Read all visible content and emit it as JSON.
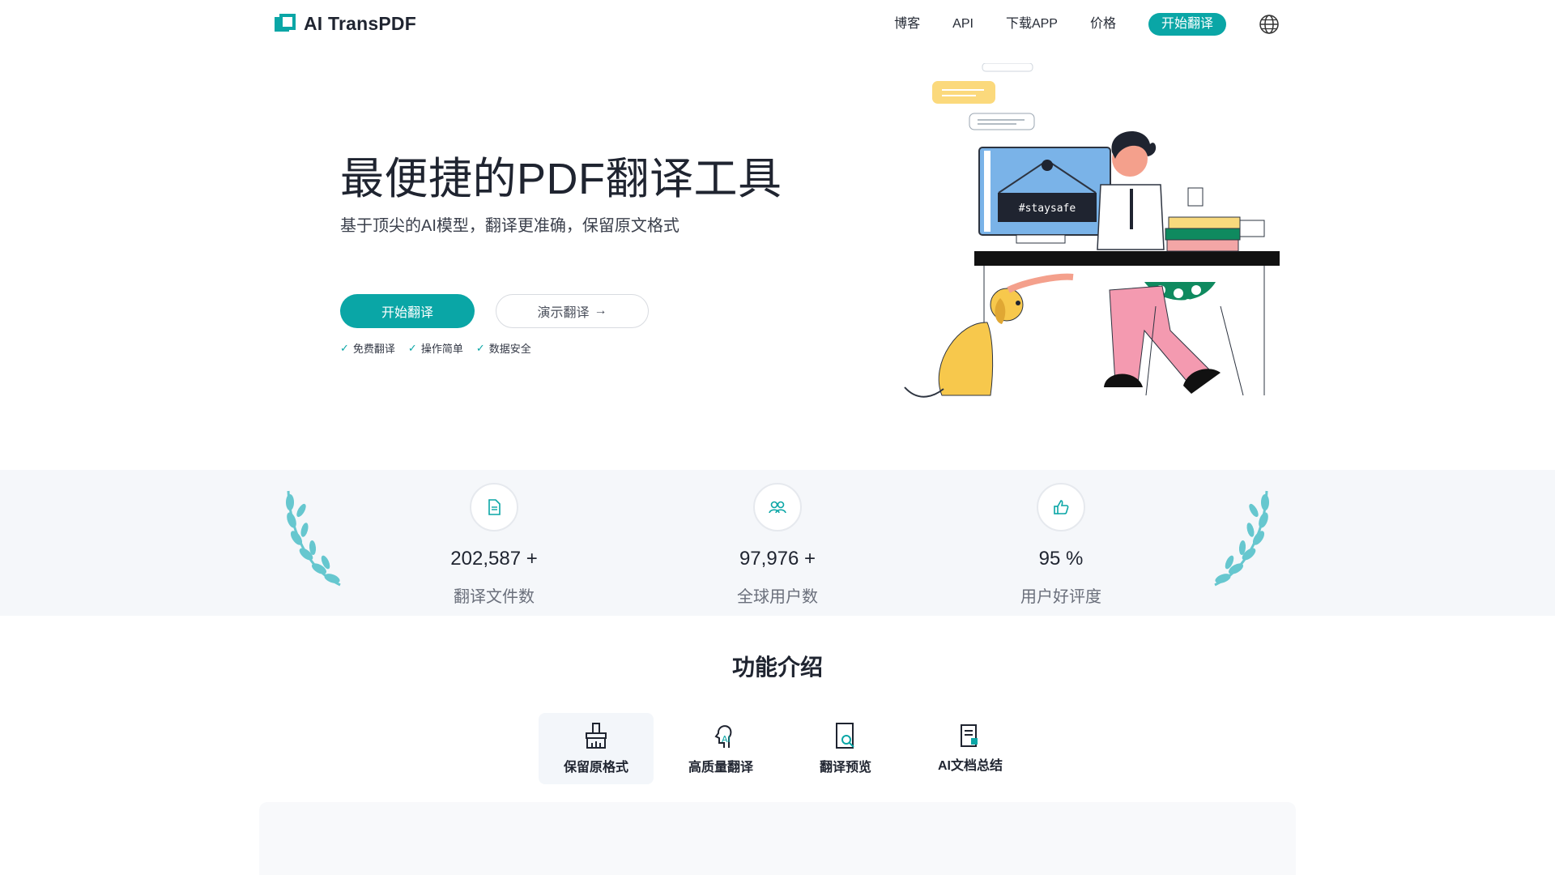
{
  "header": {
    "logo_text": "AI TransPDF",
    "nav": [
      {
        "label": "博客"
      },
      {
        "label": "API"
      },
      {
        "label": "下载APP"
      },
      {
        "label": "价格"
      }
    ],
    "cta_label": "开始翻译",
    "globe_icon": "globe-icon",
    "accent_color": "#0aa6a6"
  },
  "hero": {
    "title": "最便捷的PDF翻译工具",
    "subtitle": "基于顶尖的AI模型，翻译更准确，保留原文格式",
    "primary_button": "开始翻译",
    "secondary_button": "演示翻译",
    "secondary_arrow": "→",
    "badges": [
      "免费翻译",
      "操作简单",
      "数据安全"
    ],
    "illustration_text": "#staysafe"
  },
  "stats": [
    {
      "icon": "document-icon",
      "value": "202,587 +",
      "label": "翻译文件数"
    },
    {
      "icon": "users-icon",
      "value": "97,976 +",
      "label": "全球用户数"
    },
    {
      "icon": "thumbs-up-icon",
      "value": "95 %",
      "label": "用户好评度"
    }
  ],
  "features": {
    "title": "功能介绍",
    "tabs": [
      {
        "icon": "brush-icon",
        "label": "保留原格式",
        "active": true
      },
      {
        "icon": "ai-head-icon",
        "label": "高质量翻译",
        "active": false
      },
      {
        "icon": "preview-icon",
        "label": "翻译预览",
        "active": false
      },
      {
        "icon": "summary-icon",
        "label": "AI文档总结",
        "active": false
      }
    ]
  }
}
